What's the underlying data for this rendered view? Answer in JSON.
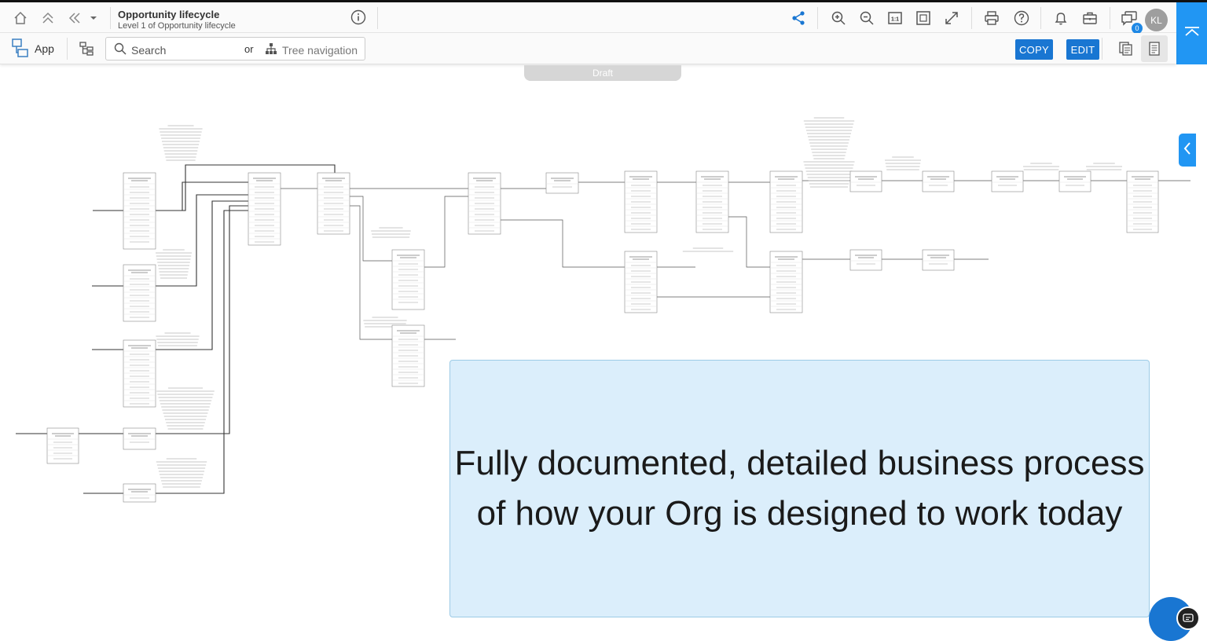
{
  "header": {
    "title": "Opportunity lifecycle",
    "subtitle": "Level 1 of Opportunity lifecycle",
    "avatar_initials": "KL",
    "notification_count": "0"
  },
  "toolbar": {
    "app_label": "App",
    "search_label": "Search",
    "or_label": "or",
    "tree_nav_label": "Tree navigation",
    "copy_label": "COPY",
    "edit_label": "EDIT"
  },
  "canvas": {
    "status_tab": "Draft",
    "callout_text": "Fully documented, detailed business process of how your Org is designed to work today"
  },
  "icons": {
    "home": "home-icon",
    "up_level": "double-chevron-up-icon",
    "back": "double-chevron-left-icon",
    "dropdown": "chevron-down-icon",
    "info": "info-icon",
    "share": "share-icon",
    "zoom_in": "zoom-in-icon",
    "zoom_out": "zoom-out-icon",
    "actual_size": "actual-size-icon",
    "fit": "fit-to-screen-icon",
    "fullscreen": "fullscreen-icon",
    "print": "print-icon",
    "help": "help-icon",
    "bell": "bell-icon",
    "briefcase": "briefcase-icon",
    "comments": "comments-icon",
    "collapse": "chevron-up-icon",
    "app": "app-icon",
    "tree": "tree-icon",
    "search": "search-icon",
    "hierarchy": "hierarchy-icon",
    "pages": "pages-icon",
    "notes": "notes-icon",
    "panel": "chevron-left-icon",
    "chat": "chat-icon"
  },
  "colors": {
    "accent": "#2196f3",
    "button_blue": "#1976d2",
    "callout_bg": "#dbeefb",
    "callout_border": "#9ccbe6"
  }
}
